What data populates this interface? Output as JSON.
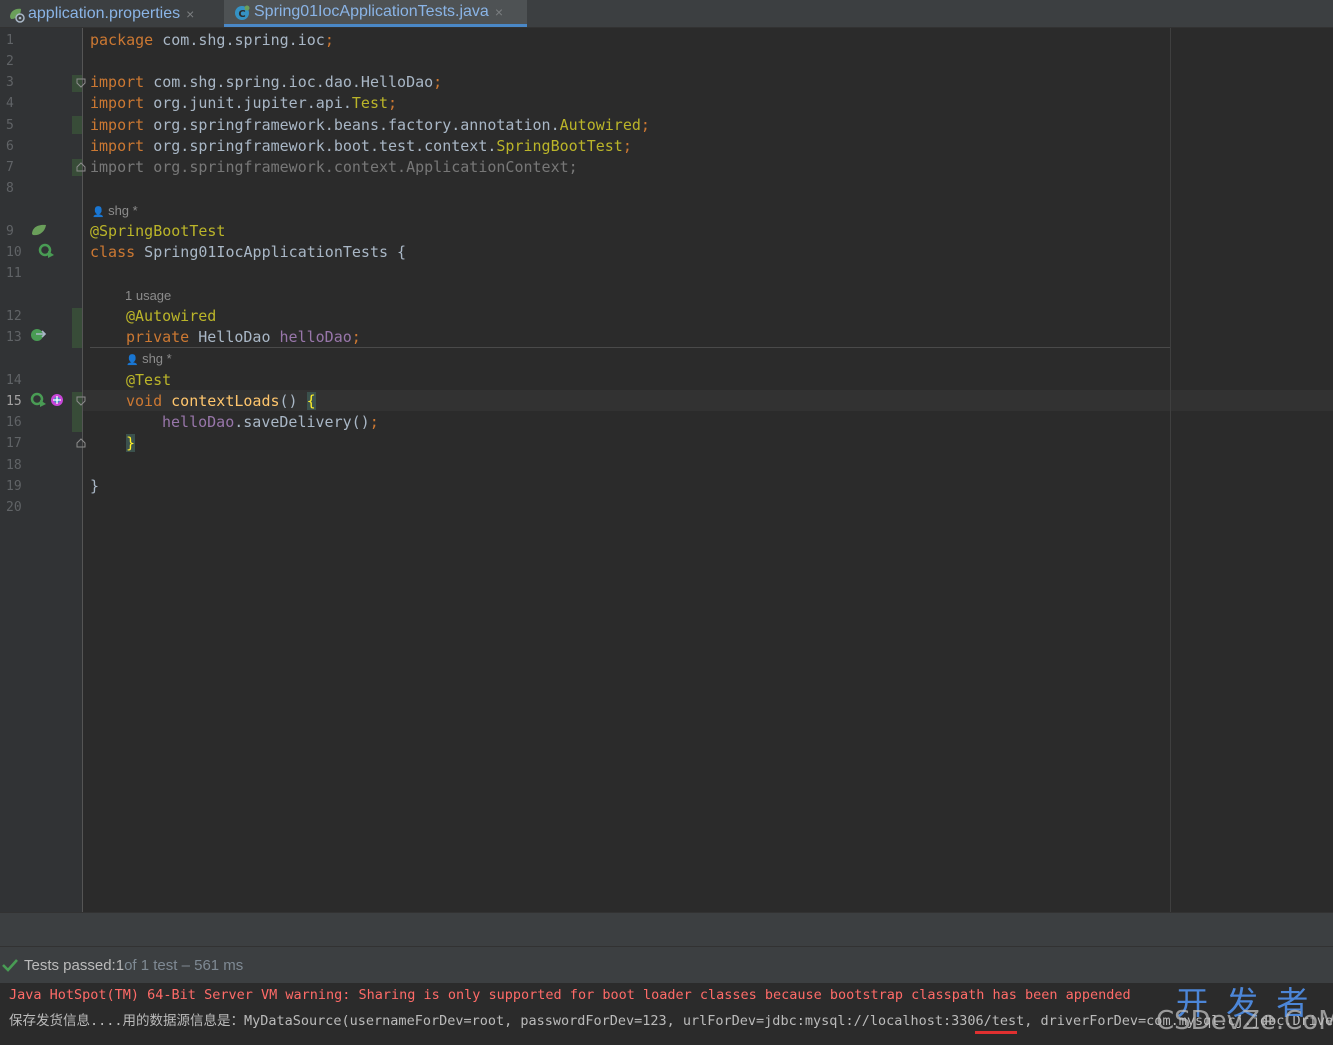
{
  "tabs": [
    {
      "label": "application.properties",
      "close": "×",
      "icon": "spring-config-icon"
    },
    {
      "label": "Spring01IocApplicationTests.java",
      "close": "×",
      "icon": "java-class-icon",
      "active": true
    }
  ],
  "line_numbers": [
    "1",
    "2",
    "3",
    "4",
    "5",
    "6",
    "7",
    "8",
    "9",
    "10",
    "11",
    "12",
    "13",
    "14",
    "15",
    "16",
    "17",
    "18",
    "19",
    "20"
  ],
  "code": {
    "l1_kw": "package",
    "l1_rest": " com.shg.spring.ioc",
    "l1_semi": ";",
    "l3_kw": "import",
    "l3_rest": " com.shg.spring.ioc.dao.HelloDao",
    "l3_semi": ";",
    "l4_kw": "import",
    "l4_rest": " org.junit.jupiter.api.",
    "l4_cls": "Test",
    "l4_semi": ";",
    "l5_kw": "import",
    "l5_rest": " org.springframework.beans.factory.annotation.",
    "l5_cls": "Autowired",
    "l5_semi": ";",
    "l6_kw": "import",
    "l6_rest": " org.springframework.boot.test.context.",
    "l6_cls": "SpringBootTest",
    "l6_semi": ";",
    "l7_kw": "import",
    "l7_rest": " org.springframework.context.ApplicationContext;",
    "hint_author_1": "shg *",
    "l9_ann": "@SpringBootTest",
    "l10_kw": "class",
    "l10_rest": " Spring01IocApplicationTests {",
    "hint_usage": "1 usage",
    "l12_ann": "@Autowired",
    "l13_kw": "private",
    "l13_type": " HelloDao ",
    "l13_fld": "helloDao",
    "l13_semi": ";",
    "hint_author_2": "shg *",
    "l14_ann": "@Test",
    "l15_kw": "void",
    "l15_meth": " contextLoads",
    "l15_paren": "() ",
    "l15_brace": "{",
    "l16_fld": "helloDao",
    "l16_rest": ".saveDelivery()",
    "l16_semi": ";",
    "l17_brace": "}",
    "l19_brace": "}"
  },
  "current_line": "15",
  "test_status": {
    "prefix": "Tests passed: ",
    "count": "1",
    "suffix": " of 1 test – 561 ms"
  },
  "console": {
    "warning": "Java HotSpot(TM) 64-Bit Server VM warning: Sharing is only supported for boot loader classes because bootstrap classpath has been appended",
    "output": "保存发货信息....用的数据源信息是：MyDataSource(usernameForDev=root, passwordForDev=123, urlForDev=jdbc:mysql://localhost:3306/test, driverForDev=com.mysql.cj.jdbc.Driver)"
  },
  "watermark": {
    "line1": "开 发 者",
    "line2": "CSDevZe.CoM"
  },
  "colors": {
    "keyword": "#cc7832",
    "annotation": "#bbb529",
    "field": "#9876aa",
    "error": "#ff6b68",
    "pass": "#499c54"
  }
}
